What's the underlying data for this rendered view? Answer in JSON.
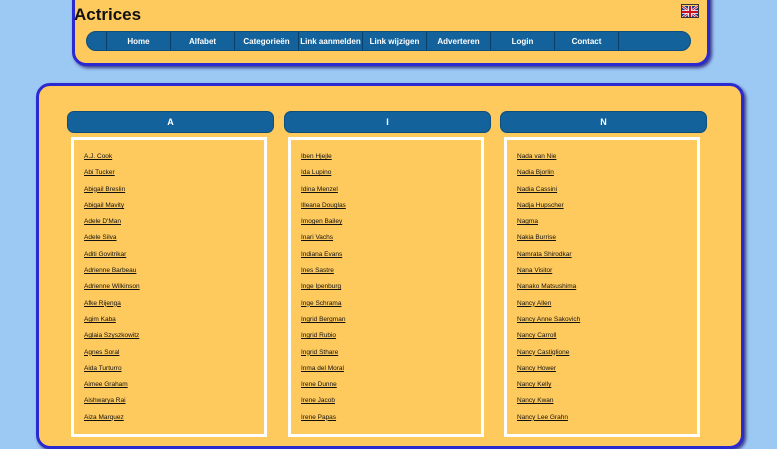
{
  "site": {
    "title": "Actrices",
    "language_flag": "uk-flag-icon"
  },
  "nav": [
    "Home",
    "Alfabet",
    "Categorieën",
    "Link aanmelden",
    "Link wijzigen",
    "Adverteren",
    "Login",
    "Contact"
  ],
  "columns": [
    {
      "letter": "A",
      "names": [
        "A.J. Cook",
        "Abi Tucker",
        "Abigail Breslin",
        "Abigail Mavity",
        "Adele D'Man",
        "Adele Silva",
        "Aditi Govitrikar",
        "Adrienne Barbeau",
        "Adrienne Wilkinson",
        "Afke Rijenga",
        "Agim Kaba",
        "Aglaia Szyszkowitz",
        "Agnes Soral",
        "Aida Turturro",
        "Aimee Graham",
        "Aishwarya Rai",
        "Aiza Marquez"
      ]
    },
    {
      "letter": "I",
      "names": [
        "Iben Hjejle",
        "Ida Lupino",
        "Idina Menzel",
        "Illeana Douglas",
        "Imogen Bailey",
        "Inari Vachs",
        "Indiana Evans",
        "Ines Sastre",
        "Inge Ipenburg",
        "Inge Schrama",
        "Ingrid Bergman",
        "Ingrid Rubio",
        "Ingrid Sthare",
        "Inma del Moral",
        "Irene Dunne",
        "Irene Jacob",
        "Irene Papas"
      ]
    },
    {
      "letter": "N",
      "names": [
        "Nada van Nie",
        "Nadia Bjorlin",
        "Nadia Cassini",
        "Nadja Hupscher",
        "Nagma",
        "Nakia Burrise",
        "Namrata Shirodkar",
        "Nana Visitor",
        "Nanako Matsushima",
        "Nancy Allen",
        "Nancy Anne Sakovich",
        "Nancy Carroll",
        "Nancy Castiglione",
        "Nancy Hower",
        "Nancy Kelly",
        "Nancy Kwan",
        "Nancy Lee Grahn"
      ]
    }
  ]
}
